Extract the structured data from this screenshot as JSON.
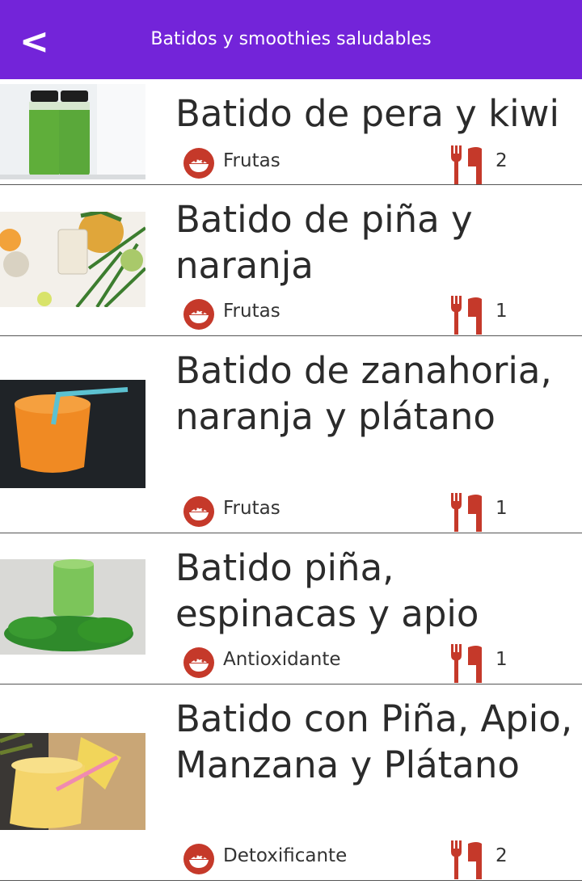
{
  "header": {
    "back_label": "<",
    "title": "Batidos y smoothies saludables"
  },
  "colors": {
    "appbar": "#7324d9",
    "icon_red": "#c5392a"
  },
  "recipes": [
    {
      "name": "Batido de pera y kiwi",
      "category": "Frutas",
      "servings": "2",
      "image": "green-juice-bottles"
    },
    {
      "name": "Batido de piña y naranja",
      "category": "Frutas",
      "servings": "1",
      "image": "pineapple-orange-drink"
    },
    {
      "name": "Batido de zanahoria, naranja y plátano",
      "category": "Frutas",
      "servings": "1",
      "image": "orange-drink-with-straw"
    },
    {
      "name": "Batido piña, espinacas y apio",
      "category": "Antioxidante",
      "servings": "1",
      "image": "green-smoothie-spinach"
    },
    {
      "name": "Batido con Piña, Apio, Manzana y Plátano",
      "category": "Detoxificante",
      "servings": "2",
      "image": "pineapple-smoothie"
    }
  ]
}
